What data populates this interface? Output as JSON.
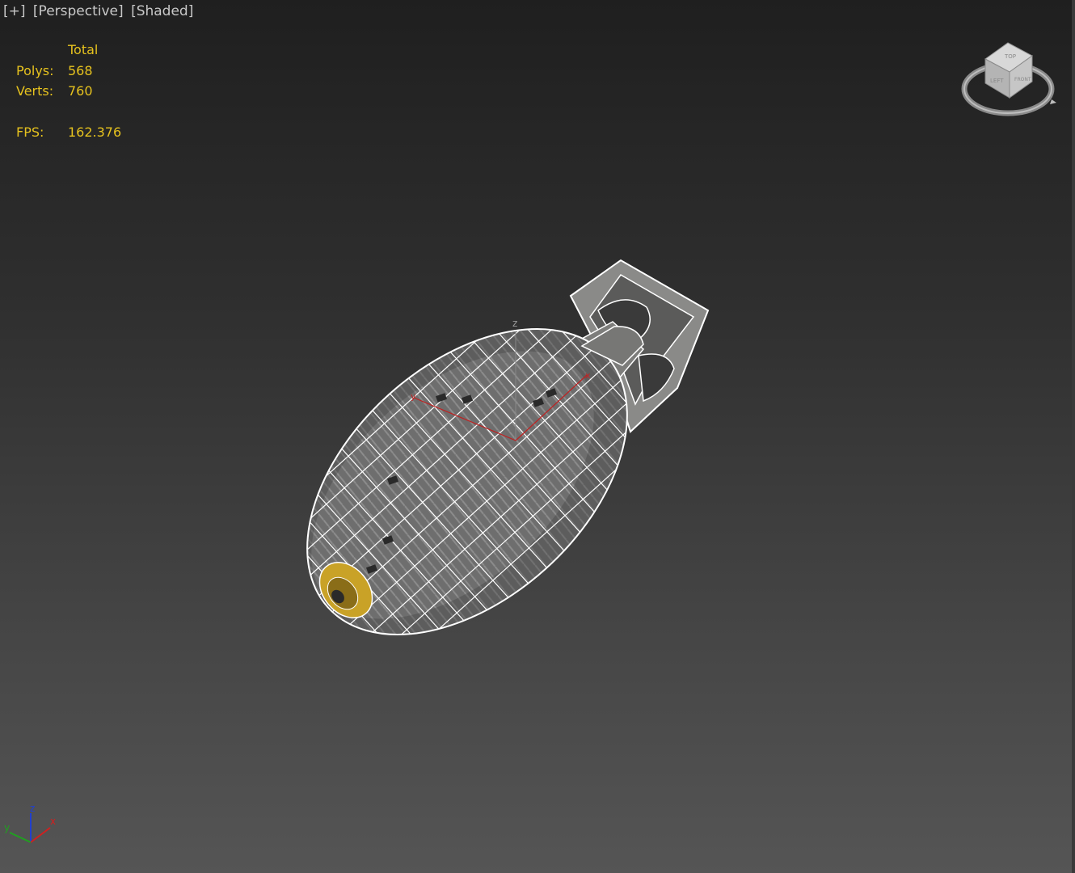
{
  "viewport": {
    "labels": [
      {
        "text": "[+]"
      },
      {
        "text": "[Perspective]"
      },
      {
        "text": "[Shaded]"
      }
    ]
  },
  "stats": {
    "header": "Total",
    "polys_label": "Polys:",
    "polys_value": "568",
    "verts_label": "Verts:",
    "verts_value": "760",
    "fps_label": "FPS:",
    "fps_value": "162.376"
  },
  "viewcube": {
    "faces": [
      "TOP",
      "LEFT",
      "FRONT"
    ]
  },
  "gizmo": {
    "axes": [
      "z",
      "y",
      "x"
    ]
  },
  "triad": {
    "axes": [
      "z",
      "y",
      "x"
    ]
  },
  "colors": {
    "stats_text": "#e6c21e",
    "label_text": "#c8c8c8",
    "x_axis": "#d02020",
    "y_axis": "#20a020",
    "z_axis": "#2040d0",
    "wire": "#ffffff",
    "nose_ring": "#c9a227"
  }
}
